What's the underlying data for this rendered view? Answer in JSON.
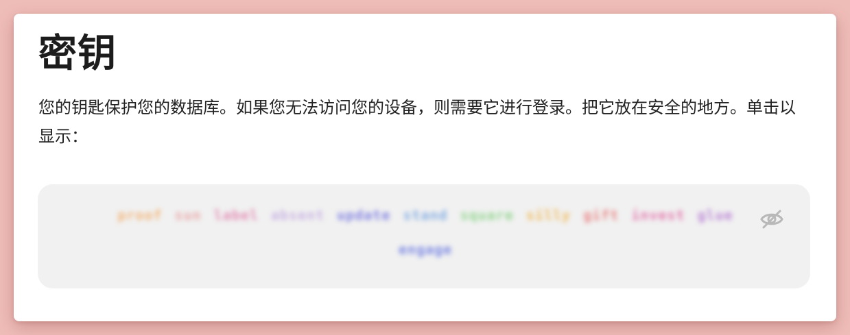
{
  "title": "密钥",
  "description": "您的钥匙保护您的数据库。如果您无法访问您的设备，则需要它进行登录。把它放在安全的地方。单击以显示：",
  "key": {
    "words": [
      {
        "text": "proof",
        "color": "#f2a860"
      },
      {
        "text": "sun",
        "color": "#e89a9a"
      },
      {
        "text": "label",
        "color": "#e07aa8"
      },
      {
        "text": "absent",
        "color": "#c2a8e0"
      },
      {
        "text": "update",
        "color": "#6b6be0"
      },
      {
        "text": "stand",
        "color": "#6fa0e0"
      },
      {
        "text": "square",
        "color": "#7fd07a"
      },
      {
        "text": "silly",
        "color": "#f0b040"
      },
      {
        "text": "gift",
        "color": "#e87070"
      },
      {
        "text": "invest",
        "color": "#e060a0"
      },
      {
        "text": "glue",
        "color": "#b070d0"
      },
      {
        "text": "engage",
        "color": "#6070e0"
      }
    ],
    "reveal_icon": "eye-slash-icon"
  }
}
